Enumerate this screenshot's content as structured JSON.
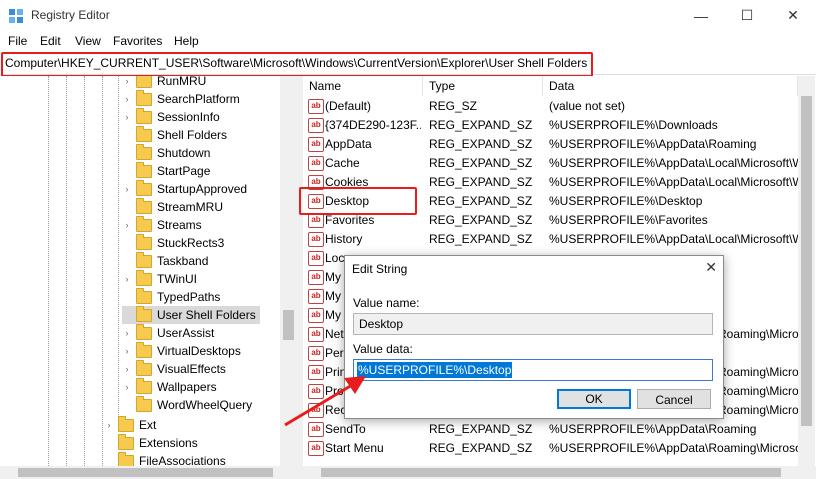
{
  "window": {
    "title": "Registry Editor",
    "minimize": "—",
    "maximize": "☐",
    "close": "✕"
  },
  "menu": [
    "File",
    "Edit",
    "View",
    "Favorites",
    "Help"
  ],
  "address": "Computer\\HKEY_CURRENT_USER\\Software\\Microsoft\\Windows\\CurrentVersion\\Explorer\\User Shell Folders",
  "tree": {
    "items": [
      {
        "label": "RunMRU",
        "expandable": true
      },
      {
        "label": "SearchPlatform",
        "expandable": true
      },
      {
        "label": "SessionInfo",
        "expandable": true
      },
      {
        "label": "Shell Folders",
        "expandable": false
      },
      {
        "label": "Shutdown",
        "expandable": false
      },
      {
        "label": "StartPage",
        "expandable": false
      },
      {
        "label": "StartupApproved",
        "expandable": true
      },
      {
        "label": "StreamMRU",
        "expandable": false
      },
      {
        "label": "Streams",
        "expandable": true
      },
      {
        "label": "StuckRects3",
        "expandable": false
      },
      {
        "label": "Taskband",
        "expandable": false
      },
      {
        "label": "TWinUI",
        "expandable": true
      },
      {
        "label": "TypedPaths",
        "expandable": false
      },
      {
        "label": "User Shell Folders",
        "expandable": false,
        "selected": true
      },
      {
        "label": "UserAssist",
        "expandable": true
      },
      {
        "label": "VirtualDesktops",
        "expandable": true
      },
      {
        "label": "VisualEffects",
        "expandable": true
      },
      {
        "label": "Wallpapers",
        "expandable": true
      },
      {
        "label": "WordWheelQuery",
        "expandable": false
      }
    ],
    "lower_items": [
      {
        "label": "Ext",
        "expandable": true
      },
      {
        "label": "Extensions",
        "expandable": false
      },
      {
        "label": "FileAssociations",
        "expandable": false
      }
    ]
  },
  "columns": {
    "name": "Name",
    "type": "Type",
    "data": "Data"
  },
  "values": [
    {
      "name": "(Default)",
      "type": "REG_SZ",
      "data": "(value not set)"
    },
    {
      "name": "{374DE290-123F...",
      "type": "REG_EXPAND_SZ",
      "data": "%USERPROFILE%\\Downloads"
    },
    {
      "name": "AppData",
      "type": "REG_EXPAND_SZ",
      "data": "%USERPROFILE%\\AppData\\Roaming"
    },
    {
      "name": "Cache",
      "type": "REG_EXPAND_SZ",
      "data": "%USERPROFILE%\\AppData\\Local\\Microsoft\\W"
    },
    {
      "name": "Cookies",
      "type": "REG_EXPAND_SZ",
      "data": "%USERPROFILE%\\AppData\\Local\\Microsoft\\W"
    },
    {
      "name": "Desktop",
      "type": "REG_EXPAND_SZ",
      "data": "%USERPROFILE%\\Desktop"
    },
    {
      "name": "Favorites",
      "type": "REG_EXPAND_SZ",
      "data": "%USERPROFILE%\\Favorites"
    },
    {
      "name": "History",
      "type": "REG_EXPAND_SZ",
      "data": "%USERPROFILE%\\AppData\\Local\\Microsoft\\W"
    },
    {
      "name": "Loc",
      "type": "",
      "data": ""
    },
    {
      "name": "My",
      "type": "",
      "data": ""
    },
    {
      "name": "My",
      "type": "",
      "data": ""
    },
    {
      "name": "My",
      "type": "",
      "data": ""
    },
    {
      "name": "Net",
      "type": "",
      "data": "Roaming\\Microsof"
    },
    {
      "name": "Per",
      "type": "",
      "data": ""
    },
    {
      "name": "Prin",
      "type": "",
      "data": "Roaming\\Microsof"
    },
    {
      "name": "Prog",
      "type": "",
      "data": "Roaming\\Microsof"
    },
    {
      "name": "Rec",
      "type": "",
      "data": "Roaming\\Microsof"
    },
    {
      "name": "SendTo",
      "type": "REG_EXPAND_SZ",
      "data": "%USERPROFILE%\\AppData\\Roaming"
    },
    {
      "name": "Start Menu",
      "type": "REG_EXPAND_SZ",
      "data": "%USERPROFILE%\\AppData\\Roaming\\Microsof"
    }
  ],
  "dialog": {
    "title": "Edit String",
    "close": "✕",
    "value_name_label": "Value name:",
    "value_name": "Desktop",
    "value_data_label": "Value data:",
    "value_data": "%USERPROFILE%\\Desktop",
    "ok": "OK",
    "cancel": "Cancel"
  },
  "colors": {
    "highlight": "#e81c1c",
    "selection": "#0078d7",
    "folder": "#f6c94f"
  }
}
